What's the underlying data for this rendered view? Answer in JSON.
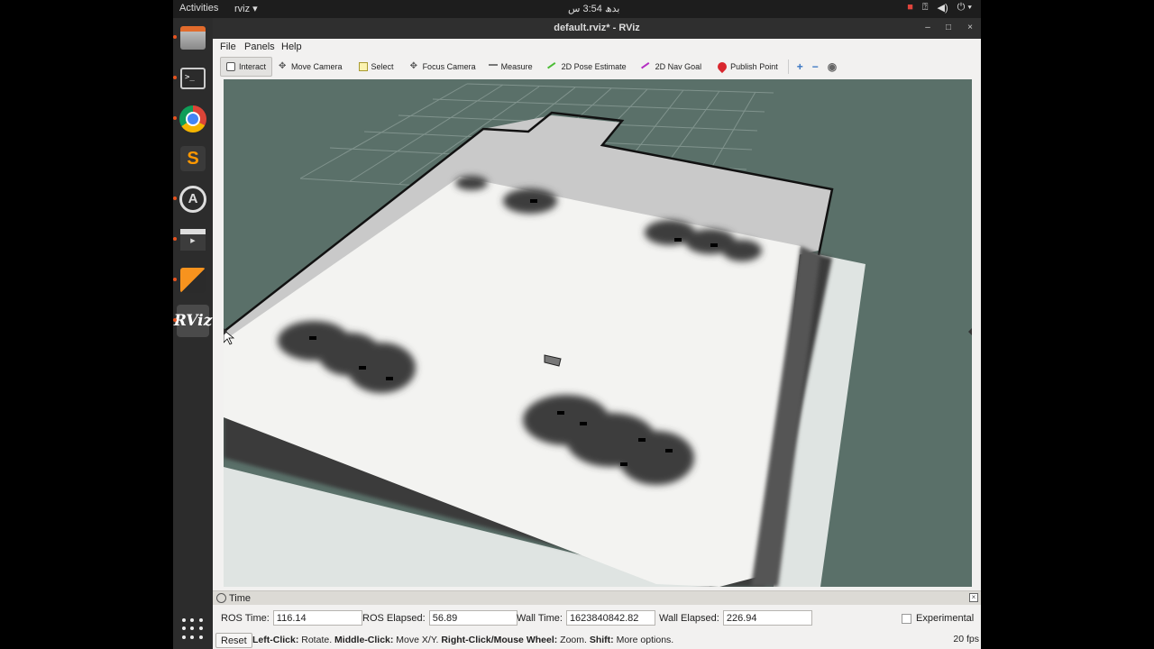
{
  "topbar": {
    "activities": "Activities",
    "app_menu": "rviz ▾",
    "clock": "بدھ 3:54 س",
    "tray_icons": [
      "record-icon",
      "accessibility-icon",
      "volume-icon",
      "power-icon"
    ]
  },
  "dock": {
    "items": [
      "files",
      "terminal",
      "chrome",
      "sublime-text",
      "software-updater",
      "video-editor",
      "package",
      "rviz"
    ],
    "active": "rviz",
    "terminal_glyph": ">_",
    "rviz_glyph": "RViz"
  },
  "window": {
    "title": "default.rviz* - RViz",
    "controls": [
      "–",
      "□",
      "×"
    ]
  },
  "menu": {
    "file": "File",
    "panels": "Panels",
    "help": "Help"
  },
  "toolbar": {
    "interact": "Interact",
    "move_camera": "Move Camera",
    "select": "Select",
    "focus_camera": "Focus Camera",
    "measure": "Measure",
    "pose_estimate": "2D Pose Estimate",
    "nav_goal": "2D Nav Goal",
    "publish_point": "Publish Point",
    "add_glyph": "+",
    "remove_glyph": "−",
    "camera_glyph": "◉"
  },
  "colors": {
    "viewport_bg": "#5a7069",
    "map_free": "#f2f2f0",
    "map_unknown": "#c8c8c8",
    "obstacle": "#3a3a3a",
    "wall": "#111111"
  },
  "time_panel": {
    "title": "Time",
    "ros_time_label": "ROS Time:",
    "ros_time": "116.14",
    "ros_elapsed_label": "ROS Elapsed:",
    "ros_elapsed": "56.89",
    "wall_time_label": "Wall Time:",
    "wall_time": "1623840842.82",
    "wall_elapsed_label": "Wall Elapsed:",
    "wall_elapsed": "226.94",
    "experimental": "Experimental"
  },
  "status": {
    "reset": "Reset",
    "left_click": "Left-Click:",
    "left_click_desc": " Rotate. ",
    "middle_click": "Middle-Click:",
    "middle_click_desc": " Move X/Y. ",
    "right_click": "Right-Click/Mouse Wheel:",
    "right_click_desc": " Zoom. ",
    "shift": "Shift:",
    "shift_desc": " More options.",
    "fps": "20 fps"
  }
}
